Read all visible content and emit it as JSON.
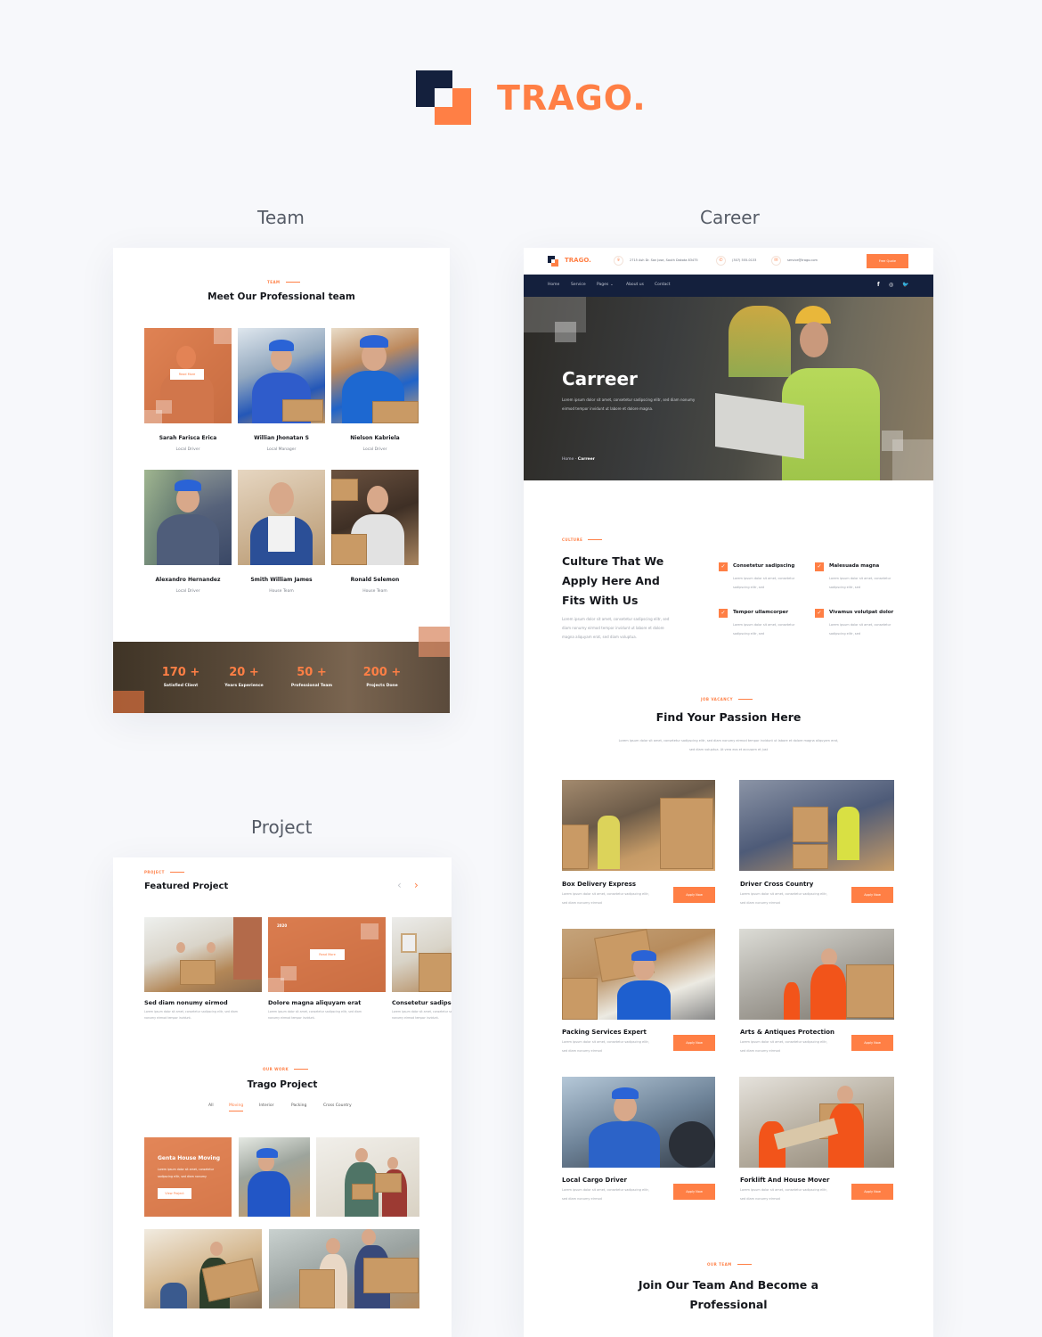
{
  "brand": {
    "name": "TRAGO.",
    "accent": "#ff7f45",
    "navy": "#14203d"
  },
  "captions": {
    "team": "Team",
    "career": "Career",
    "project": "Project"
  },
  "team": {
    "eyebrow": "TEAM",
    "title": "Meet Our Professional team",
    "hover_button": "Read More",
    "members": [
      {
        "name": "Sarah Farisca Erica",
        "role": "Local Driver"
      },
      {
        "name": "Willian Jhonatan S",
        "role": "Local Manager"
      },
      {
        "name": "Nielson Kabriela",
        "role": "Local Driver"
      },
      {
        "name": "Alexandro Hernandez",
        "role": "Local Driver"
      },
      {
        "name": "Smith William James",
        "role": "House Team"
      },
      {
        "name": "Ronald Selemon",
        "role": "House Team"
      }
    ],
    "stats": [
      {
        "value": "170 +",
        "label": "Satisfied Client"
      },
      {
        "value": "20 +",
        "label": "Years Experience"
      },
      {
        "value": "50 +",
        "label": "Professional Team"
      },
      {
        "value": "200 +",
        "label": "Projects Done"
      }
    ]
  },
  "career": {
    "header": {
      "logo": "TRAGO.",
      "address": "2715 Ash Dr. San Jose, South Dakota 83475",
      "phone": "(307) 555-0133",
      "email": "service@trago.com",
      "quote_button": "Free Quote"
    },
    "nav": {
      "items": [
        "Home",
        "Service",
        "Pages",
        "About us",
        "Contact"
      ],
      "social": [
        "facebook",
        "instagram",
        "twitter"
      ]
    },
    "hero": {
      "title": "Carreer",
      "subtitle": "Lorem ipsum dolor sit amet, consetetur sadipscing elitr, sed diam nonumy eirmod tempor invidunt ut labore et dolore magna.",
      "breadcrumb_home": "Home - ",
      "breadcrumb_current": "Carreer"
    },
    "culture": {
      "eyebrow": "CULTURE",
      "title_lines": [
        "Culture That We",
        "Apply Here And",
        "Fits With Us"
      ],
      "body": "Lorem ipsum dolor sit amet, consetetur sadipscing elitr, sed diam nonumy eirmod tempor invidunt ut labore et dolore magna aliquyam erat, sed diam voluptua.",
      "features": [
        {
          "title": "Consetetur sadipscing",
          "text": "Lorem ipsum dolor sit amet, consetetur sadipscing elitr, sed"
        },
        {
          "title": "Malesuada magna",
          "text": "Lorem ipsum dolor sit amet, consetetur sadipscing elitr, sed"
        },
        {
          "title": "Tempor ullamcorper",
          "text": "Lorem ipsum dolor sit amet, consetetur sadipscing elitr, sed"
        },
        {
          "title": "Vivamus volutpat dolor",
          "text": "Lorem ipsum dolor sit amet, consetetur sadipscing elitr, sed"
        }
      ]
    },
    "jobs": {
      "eyebrow": "JOB VACANCY",
      "title": "Find Your Passion Here",
      "intro": "Lorem ipsum dolor sit amet, consetetur sadipscing elitr, sed diam nonumy eirmod tempor invidunt ut labore et dolore magna aliquyam erat, sed diam voluptua. At vero eos et accusam et just",
      "apply_label": "Apply Now",
      "items": [
        {
          "title": "Box Delivery Express",
          "desc": "Lorem ipsum dolor sit amet, consetetur sadipscing elitr, sed diam nonumy eirmod"
        },
        {
          "title": "Driver Cross Country",
          "desc": "Lorem ipsum dolor sit amet, consetetur sadipscing elitr, sed diam nonumy eirmod"
        },
        {
          "title": "Packing Services Expert",
          "desc": "Lorem ipsum dolor sit amet, consetetur sadipscing elitr, sed diam nonumy eirmod"
        },
        {
          "title": "Arts & Antiques Protection",
          "desc": "Lorem ipsum dolor sit amet, consetetur sadipscing elitr, sed diam nonumy eirmod"
        },
        {
          "title": "Local Cargo Driver",
          "desc": "Lorem ipsum dolor sit amet, consetetur sadipscing elitr, sed diam nonumy eirmod"
        },
        {
          "title": "Forklift And House Mover",
          "desc": "Lorem ipsum dolor sit amet, consetetur sadipscing elitr, sed diam nonumy eirmod"
        }
      ]
    },
    "join": {
      "eyebrow": "OUR TEAM",
      "title_lines": [
        "Join Our Team And Become a",
        "Professional"
      ]
    }
  },
  "project": {
    "featured": {
      "eyebrow": "PROJECT",
      "title": "Featured Project",
      "read_more": "Read More",
      "year_badge": "2020",
      "items": [
        {
          "title": "Sed diam nonumy eirmod",
          "desc": "Lorem ipsum dolor sit amet, consetetur sadipscing elitr, sed diam nonumy eirmod tempor invidunt."
        },
        {
          "title": "Dolore magna aliquyam erat",
          "desc": "Lorem ipsum dolor sit amet, consetetur sadipscing elitr, sed diam nonumy eirmod tempor invidunt."
        },
        {
          "title": "Consetetur sadipscing",
          "desc": "Lorem ipsum dolor sit amet, consetetur sadipscing elitr, sed diam nonumy eirmod tempor invidunt."
        }
      ]
    },
    "work": {
      "eyebrow": "OUR WORK",
      "title": "Trago Project",
      "filters": [
        "All",
        "Moving",
        "Interior",
        "Packing",
        "Cross Country"
      ],
      "active_filter": "Moving",
      "highlight": {
        "title": "Genta House Moving",
        "desc": "Lorem ipsum dolor sit amet, consetetur sadipscing elitr, sed diam nonumy",
        "button": "View Project"
      }
    }
  }
}
